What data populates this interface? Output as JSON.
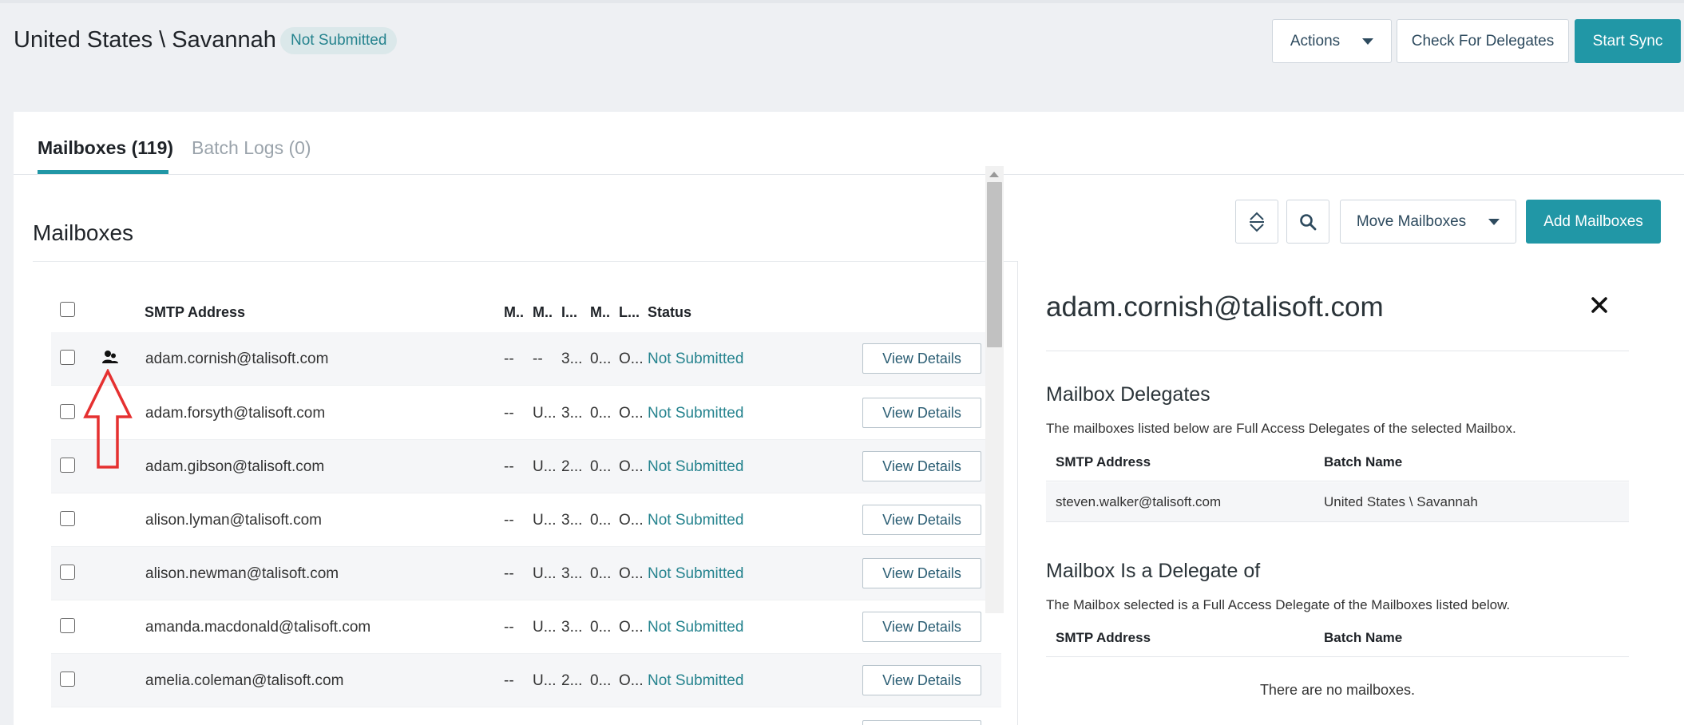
{
  "header": {
    "title": "United States \\ Savannah",
    "status": "Not Submitted",
    "actions_label": "Actions",
    "check_delegates_label": "Check For Delegates",
    "start_sync_label": "Start Sync"
  },
  "tabs": [
    {
      "label": "Mailboxes (119)",
      "active": true
    },
    {
      "label": "Batch Logs (0)",
      "active": false
    }
  ],
  "section": {
    "title": "Mailboxes",
    "move_label": "Move Mailboxes",
    "add_label": "Add Mailboxes"
  },
  "table": {
    "columns": [
      "SMTP Address",
      "M..",
      "M..",
      "I...",
      "M..",
      "L...",
      "Status"
    ],
    "view_label": "View Details",
    "rows": [
      {
        "email": "adam.cornish@talisoft.com",
        "c1": "--",
        "c2": "--",
        "c3": "3...",
        "c4": "0...",
        "c5": "O...",
        "status": "Not Submitted",
        "delegate_icon": true
      },
      {
        "email": "adam.forsyth@talisoft.com",
        "c1": "--",
        "c2": "U...",
        "c3": "3...",
        "c4": "0...",
        "c5": "O...",
        "status": "Not Submitted"
      },
      {
        "email": "adam.gibson@talisoft.com",
        "c1": "--",
        "c2": "U...",
        "c3": "2...",
        "c4": "0...",
        "c5": "O...",
        "status": "Not Submitted"
      },
      {
        "email": "alison.lyman@talisoft.com",
        "c1": "--",
        "c2": "U...",
        "c3": "3...",
        "c4": "0...",
        "c5": "O...",
        "status": "Not Submitted"
      },
      {
        "email": "alison.newman@talisoft.com",
        "c1": "--",
        "c2": "U...",
        "c3": "3...",
        "c4": "0...",
        "c5": "O...",
        "status": "Not Submitted"
      },
      {
        "email": "amanda.macdonald@talisoft.com",
        "c1": "--",
        "c2": "U...",
        "c3": "3...",
        "c4": "0...",
        "c5": "O...",
        "status": "Not Submitted"
      },
      {
        "email": "amelia.coleman@talisoft.com",
        "c1": "--",
        "c2": "U...",
        "c3": "2...",
        "c4": "0...",
        "c5": "O...",
        "status": "Not Submitted"
      }
    ]
  },
  "details": {
    "title": "adam.cornish@talisoft.com",
    "delegates_heading": "Mailbox Delegates",
    "delegates_desc": "The mailboxes listed below are Full Access Delegates of the selected Mailbox.",
    "col_smtp": "SMTP Address",
    "col_batch": "Batch Name",
    "delegates": [
      {
        "smtp": "steven.walker@talisoft.com",
        "batch": "United States \\ Savannah"
      }
    ],
    "delegate_of_heading": "Mailbox Is a Delegate of",
    "delegate_of_desc": "The Mailbox selected is a Full Access Delegate of the Mailboxes listed below.",
    "empty_msg": "There are no mailboxes."
  },
  "colors": {
    "accent": "#2197a6",
    "status_text": "#25838e",
    "annotation": "#e53030"
  }
}
